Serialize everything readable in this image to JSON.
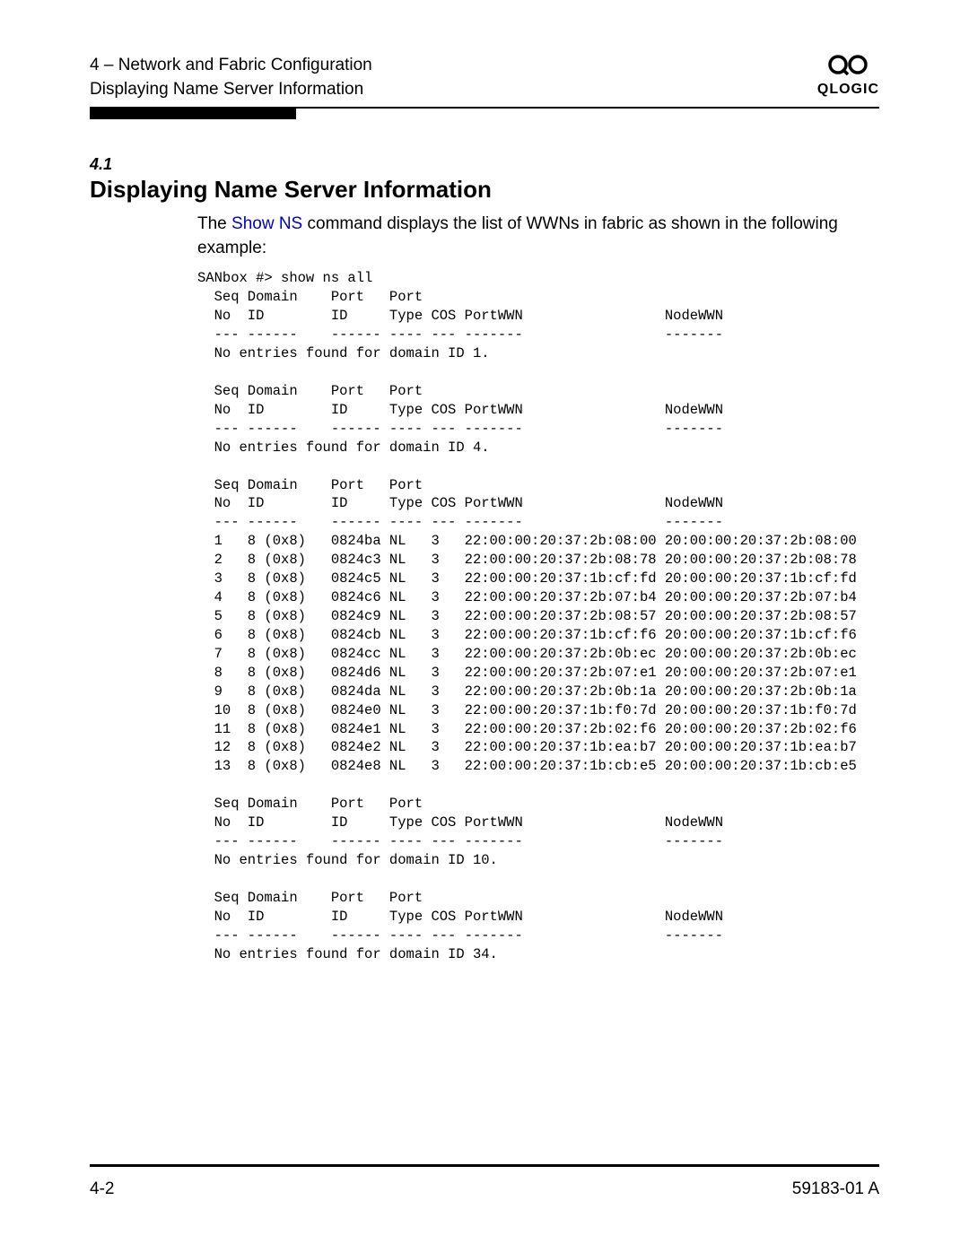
{
  "header": {
    "chapter_line": "4 – Network and Fabric Configuration",
    "subtitle": "Displaying Name Server Information",
    "logo_brand": "QLOGIC"
  },
  "section": {
    "number": "4.1",
    "title": "Displaying Name Server Information",
    "intro_prefix": "The ",
    "intro_link": "Show NS",
    "intro_suffix": " command displays the list of WWNs in fabric as shown in the following example:"
  },
  "code": {
    "text": "SANbox #> show ns all\n  Seq Domain    Port   Port\n  No  ID        ID     Type COS PortWWN                 NodeWWN\n  --- ------    ------ ---- --- -------                 -------\n  No entries found for domain ID 1.\n\n  Seq Domain    Port   Port\n  No  ID        ID     Type COS PortWWN                 NodeWWN\n  --- ------    ------ ---- --- -------                 -------\n  No entries found for domain ID 4.\n\n  Seq Domain    Port   Port\n  No  ID        ID     Type COS PortWWN                 NodeWWN\n  --- ------    ------ ---- --- -------                 -------\n  1   8 (0x8)   0824ba NL   3   22:00:00:20:37:2b:08:00 20:00:00:20:37:2b:08:00\n  2   8 (0x8)   0824c3 NL   3   22:00:00:20:37:2b:08:78 20:00:00:20:37:2b:08:78\n  3   8 (0x8)   0824c5 NL   3   22:00:00:20:37:1b:cf:fd 20:00:00:20:37:1b:cf:fd\n  4   8 (0x8)   0824c6 NL   3   22:00:00:20:37:2b:07:b4 20:00:00:20:37:2b:07:b4\n  5   8 (0x8)   0824c9 NL   3   22:00:00:20:37:2b:08:57 20:00:00:20:37:2b:08:57\n  6   8 (0x8)   0824cb NL   3   22:00:00:20:37:1b:cf:f6 20:00:00:20:37:1b:cf:f6\n  7   8 (0x8)   0824cc NL   3   22:00:00:20:37:2b:0b:ec 20:00:00:20:37:2b:0b:ec\n  8   8 (0x8)   0824d6 NL   3   22:00:00:20:37:2b:07:e1 20:00:00:20:37:2b:07:e1\n  9   8 (0x8)   0824da NL   3   22:00:00:20:37:2b:0b:1a 20:00:00:20:37:2b:0b:1a\n  10  8 (0x8)   0824e0 NL   3   22:00:00:20:37:1b:f0:7d 20:00:00:20:37:1b:f0:7d\n  11  8 (0x8)   0824e1 NL   3   22:00:00:20:37:2b:02:f6 20:00:00:20:37:2b:02:f6\n  12  8 (0x8)   0824e2 NL   3   22:00:00:20:37:1b:ea:b7 20:00:00:20:37:1b:ea:b7\n  13  8 (0x8)   0824e8 NL   3   22:00:00:20:37:1b:cb:e5 20:00:00:20:37:1b:cb:e5\n\n  Seq Domain    Port   Port\n  No  ID        ID     Type COS PortWWN                 NodeWWN\n  --- ------    ------ ---- --- -------                 -------\n  No entries found for domain ID 10.\n\n  Seq Domain    Port   Port\n  No  ID        ID     Type COS PortWWN                 NodeWWN\n  --- ------    ------ ---- --- -------                 -------\n  No entries found for domain ID 34."
  },
  "footer": {
    "page_number": "4-2",
    "doc_number": "59183-01 A"
  }
}
